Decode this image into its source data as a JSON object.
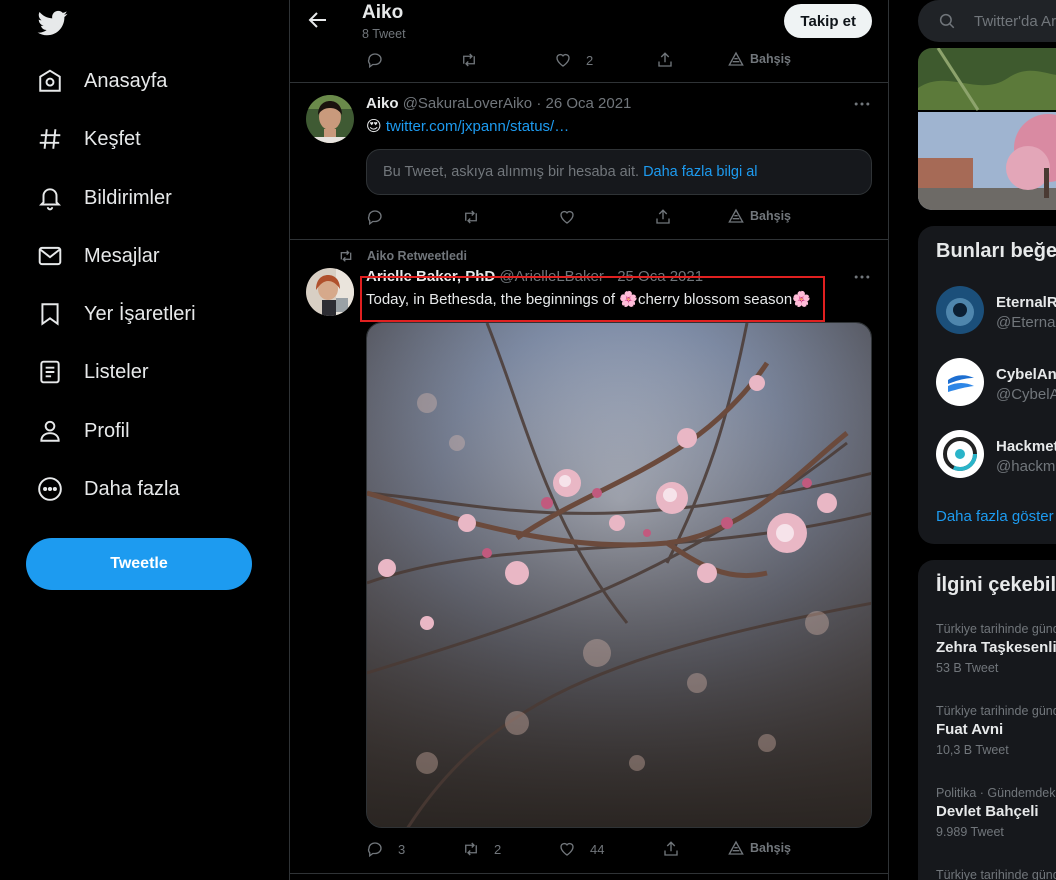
{
  "nav": {
    "items": [
      {
        "label": "Anasayfa",
        "icon": "home-icon"
      },
      {
        "label": "Keşfet",
        "icon": "hashtag-icon"
      },
      {
        "label": "Bildirimler",
        "icon": "bell-icon"
      },
      {
        "label": "Mesajlar",
        "icon": "mail-icon"
      },
      {
        "label": "Yer İşaretleri",
        "icon": "bookmark-icon"
      },
      {
        "label": "Listeler",
        "icon": "list-icon"
      },
      {
        "label": "Profil",
        "icon": "user-icon"
      },
      {
        "label": "Daha fazla",
        "icon": "more-circle-icon"
      }
    ],
    "tweet_button": "Tweetle"
  },
  "header": {
    "title": "Aiko",
    "subtitle": "8 Tweet",
    "follow_button": "Takip et"
  },
  "top_actions": {
    "like_count": "2",
    "tip_label": "Bahşiş"
  },
  "tweet1": {
    "name": "Aiko",
    "handle": "@SakuraLoverAiko",
    "sep": "·",
    "date": "26 Oca 2021",
    "emoji": "😍",
    "link": "twitter.com/jxpann/status/…",
    "suspended_text": "Bu Tweet, askıya alınmış bir hesaba ait.",
    "suspended_link": "Daha fazla bilgi al",
    "tip_label": "Bahşiş"
  },
  "tweet2": {
    "retweeted_by": "Aiko Retweetledi",
    "name": "Arielle Baker, PhD",
    "handle": "@ArielleLBaker",
    "sep": "·",
    "date": "25 Oca 2021",
    "text_before": "Today, in Bethesda, the beginnings of ",
    "text_middle": "cherry blossom season",
    "flower": "🌸",
    "reply_count": "3",
    "retweet_count": "2",
    "like_count": "44",
    "tip_label": "Bahşiş"
  },
  "right": {
    "search_placeholder": "Twitter'da Ara",
    "who_to_follow_title": "Bunları beğenebilirsin",
    "suggestions": [
      {
        "name": "EternalRise",
        "handle": "@EternalRise"
      },
      {
        "name": "CybelAngel",
        "handle": "@CybelAngel"
      },
      {
        "name": "Hackmetrix",
        "handle": "@hackmetrix"
      }
    ],
    "show_more": "Daha fazla göster",
    "trends_title": "İlgini çekebilecek gündemler",
    "trends": [
      {
        "context": "Türkiye tarihinde gündemde",
        "name": "Zehra Taşkesenlioğlu",
        "count": "53 B Tweet"
      },
      {
        "context": "Türkiye tarihinde gündemde",
        "name": "Fuat Avni",
        "count": "10,3 B Tweet"
      },
      {
        "context": "Politika · Gündemdekiler",
        "name": "Devlet Bahçeli",
        "count": "9.989 Tweet"
      },
      {
        "context": "Türkiye tarihinde gündemde",
        "name": "",
        "count": ""
      }
    ]
  },
  "colors": {
    "accent": "#1d9bf0",
    "highlight": "#e02020",
    "background": "#000000"
  }
}
